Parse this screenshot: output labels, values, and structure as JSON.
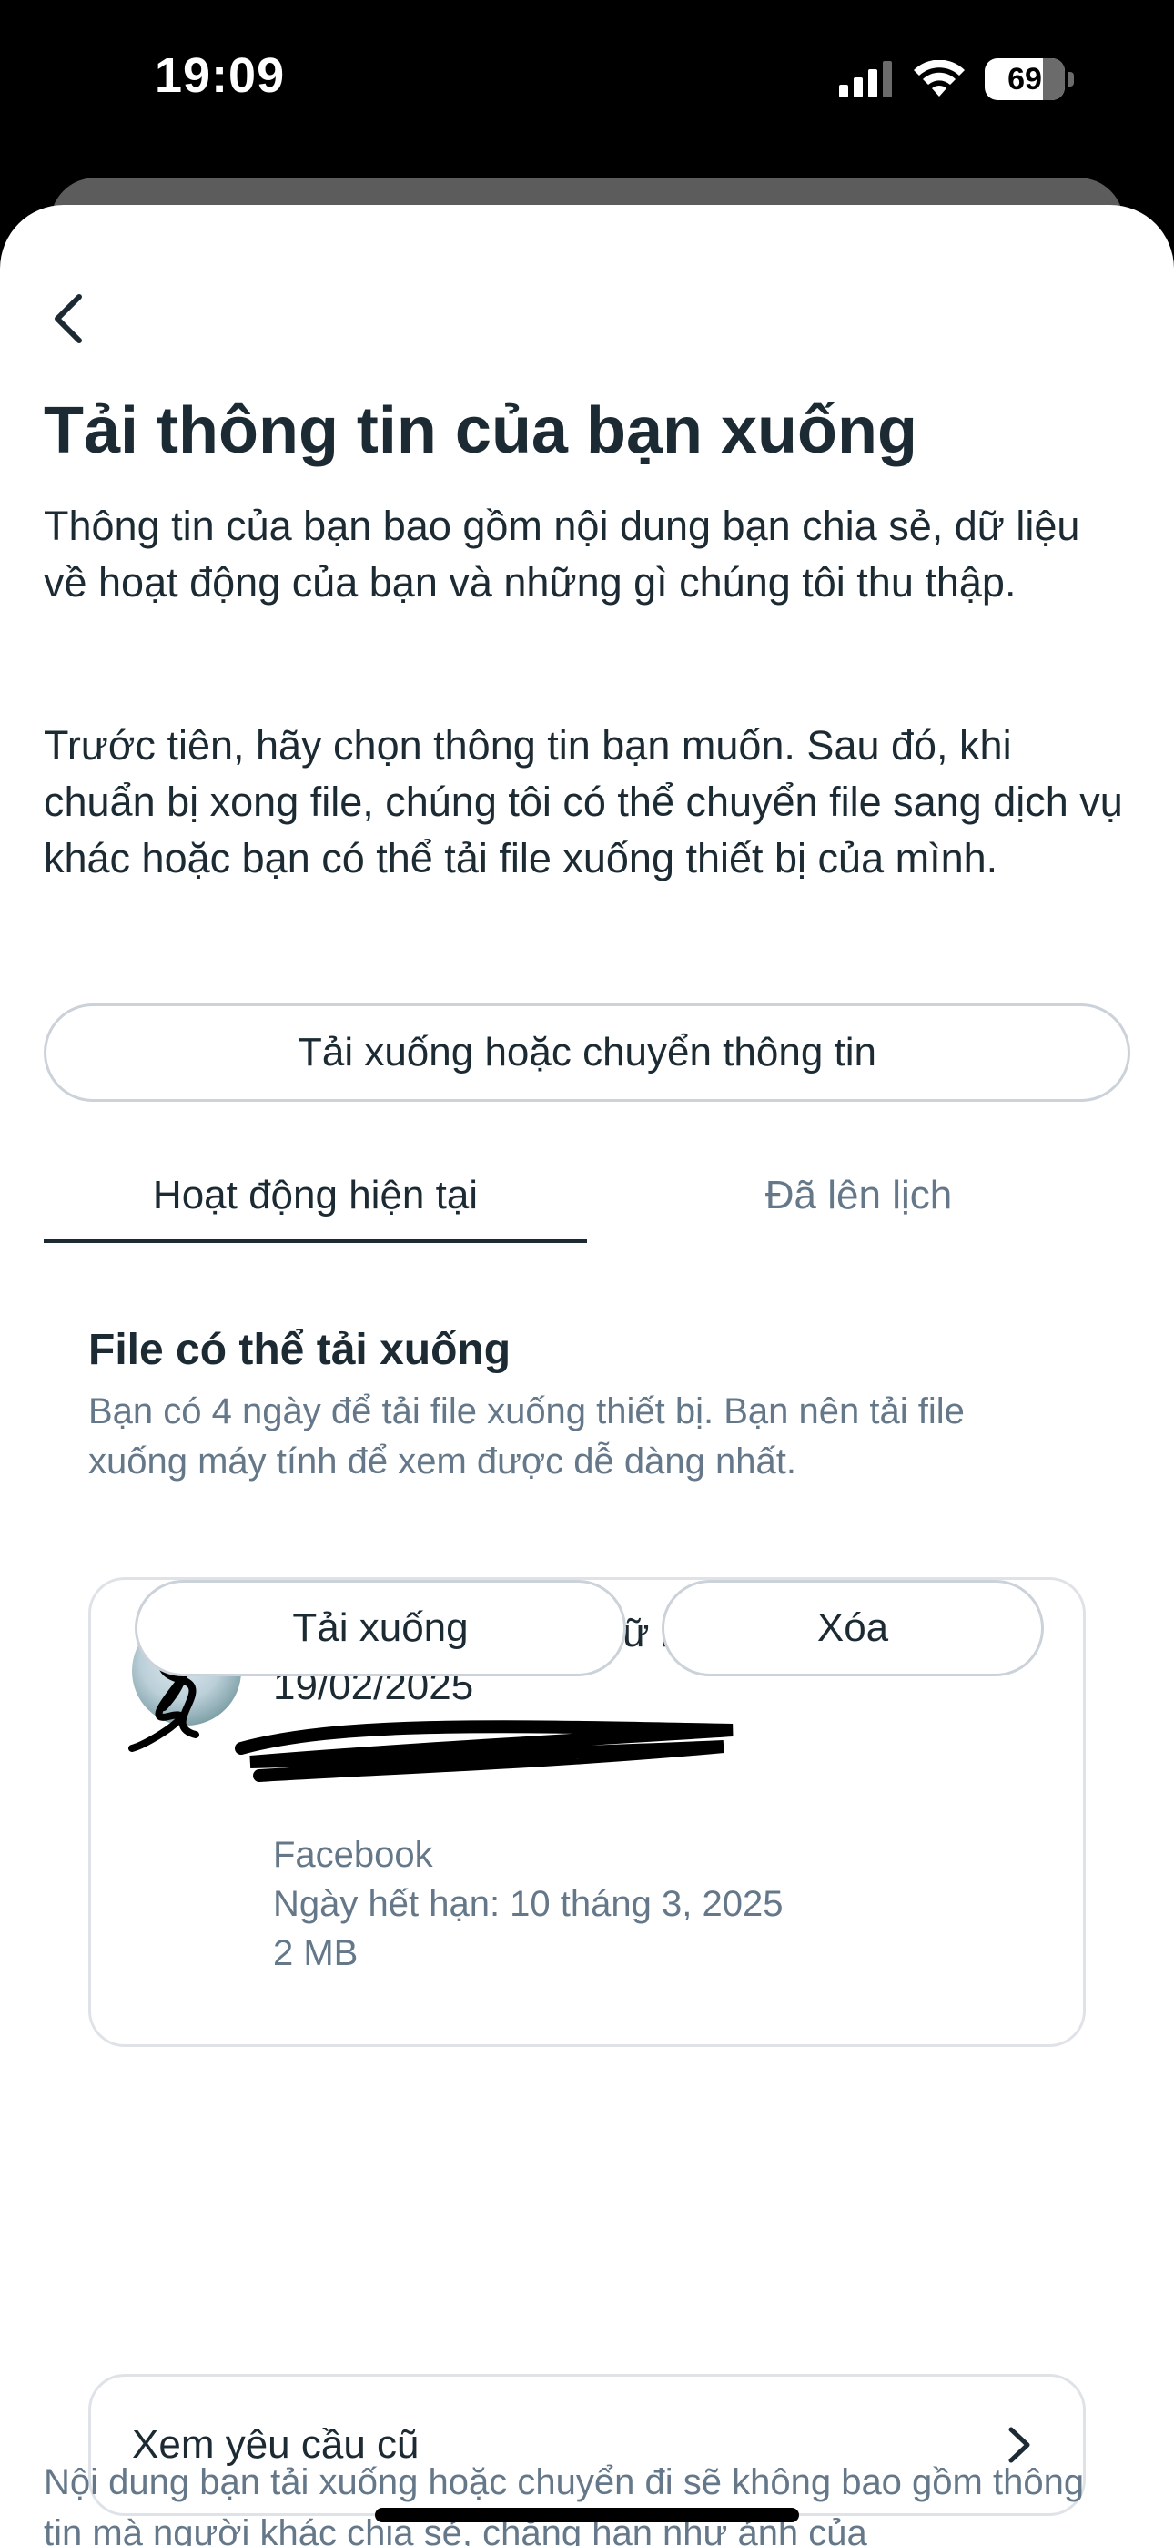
{
  "status_bar": {
    "time": "19:09",
    "battery": "69",
    "icons": [
      "signal-icon",
      "wifi-icon",
      "battery-icon"
    ]
  },
  "header": {
    "back_icon": "chevron-left-icon",
    "title": "Tải thông tin của bạn xuống"
  },
  "intro": {
    "paragraph1": "Thông tin của bạn bao gồm nội dung bạn chia sẻ, dữ liệu về hoạt động của bạn và những gì chúng tôi thu thập.",
    "paragraph2": "Trước tiên, hãy chọn thông tin bạn muốn. Sau đó, khi chuẩn bị xong file, chúng tôi có thể chuyển file sang dịch vụ khác hoặc bạn có thể tải file xuống thiết bị của mình."
  },
  "main_action": {
    "label": "Tải xuống hoặc chuyển thông tin"
  },
  "tabs": [
    {
      "label": "Hoạt động hiện tại",
      "active": true
    },
    {
      "label": "Đã lên lịch",
      "active": false
    }
  ],
  "downloads": {
    "title": "File có thể tải xuống",
    "subtitle": "Bạn có 4 ngày để tải file xuống thiết bị. Bạn nên tải file xuống máy tính để xem được dễ dàng nhất.",
    "file": {
      "title": "Tải xuống nhật ký dữ liệu từ 12/02/2025 – 19/02/2025",
      "owner": "",
      "source": "Facebook",
      "expiry": "Ngày hết hạn: 10 tháng 3, 2025",
      "size": "2 MB",
      "download_label": "Tải xuống",
      "delete_label": "Xóa"
    }
  },
  "old_requests": {
    "label": "Xem yêu cầu cũ",
    "icon": "chevron-right-icon"
  },
  "footer": {
    "note": "Nội dung bạn tải xuống hoặc chuyển đi sẽ không bao gồm thông tin mà người khác chia sẻ, chẳng hạn như ảnh của"
  },
  "colors": {
    "text_primary": "#1c2b33",
    "text_secondary": "#65788a",
    "border": "#cbd2d9"
  }
}
